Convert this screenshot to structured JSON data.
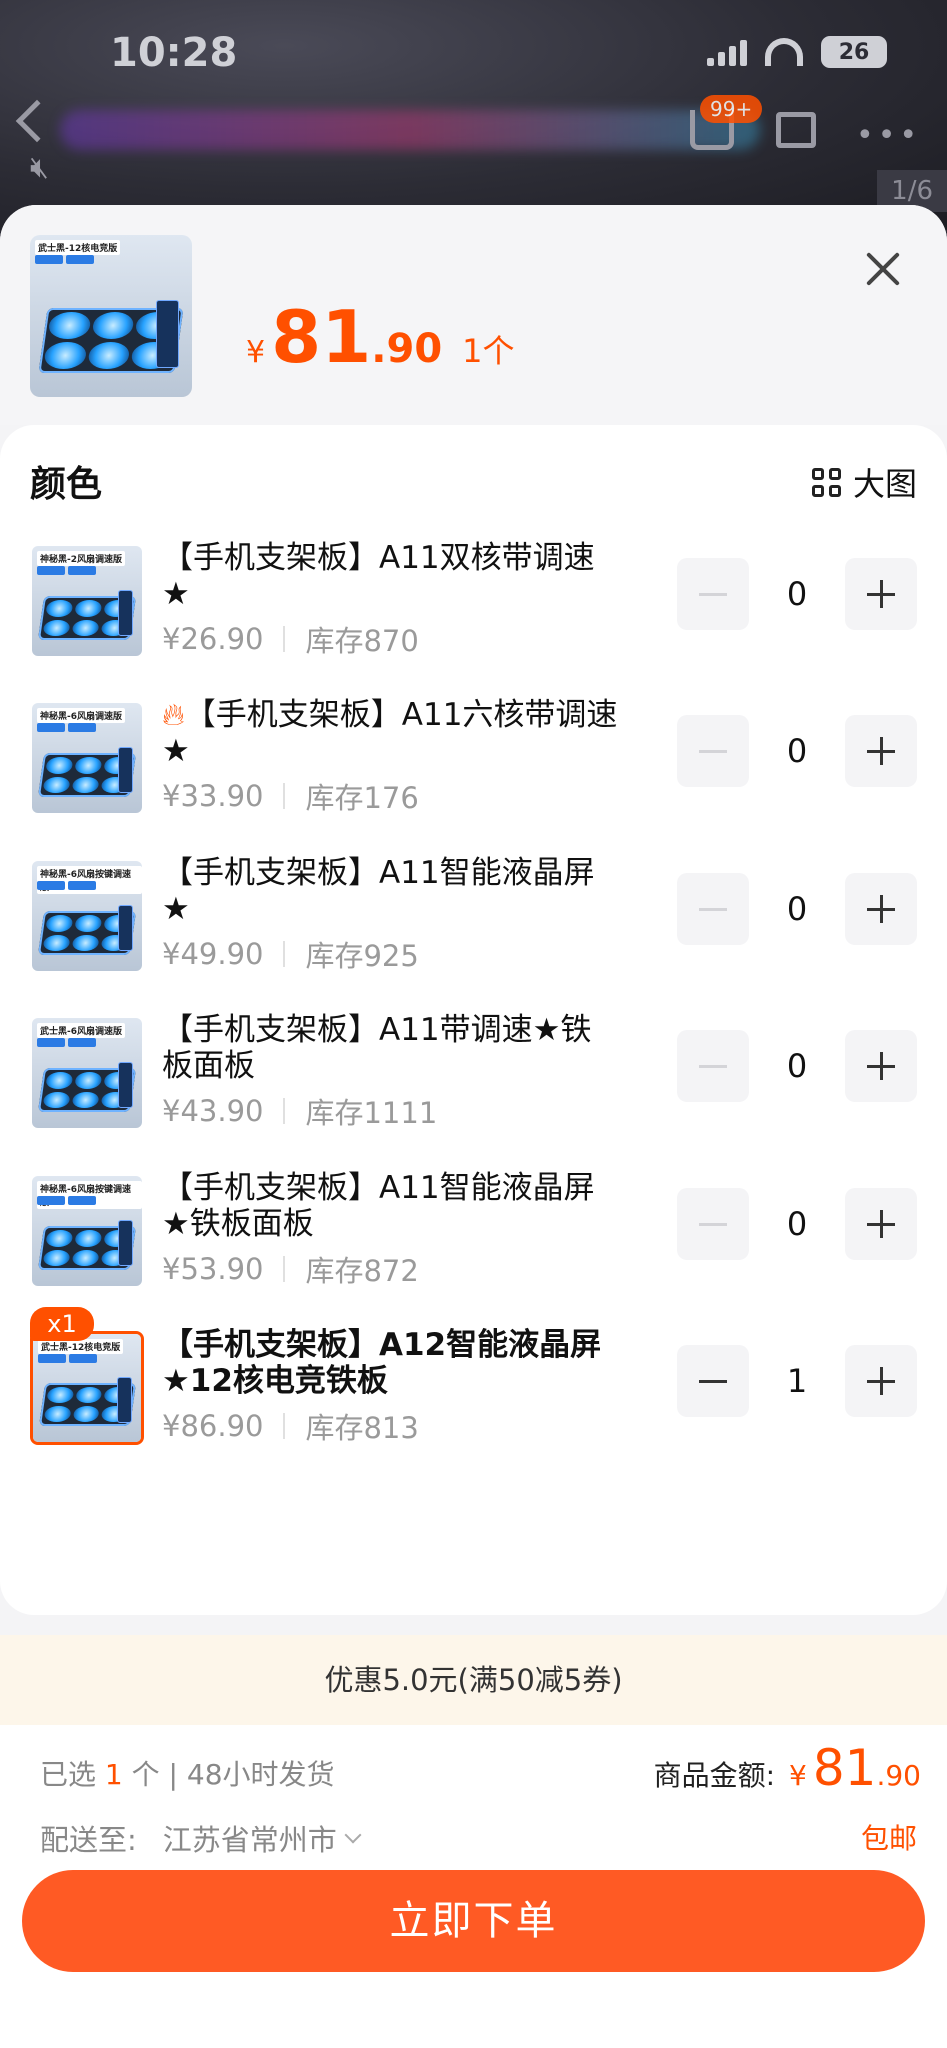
{
  "status_bar": {
    "time": "10:28",
    "battery": "26"
  },
  "top_nav": {
    "cart_badge": "99+",
    "pager": "1/6"
  },
  "sheet": {
    "price_currency": "¥",
    "price_int": "81",
    "price_dec": ".90",
    "quantity": "1个",
    "section_title": "颜色",
    "big_image_label": "大图",
    "head_thumb_label": "武士黑-12核电竞版"
  },
  "items": [
    {
      "name": "【手机支架板】A11双核带调速★",
      "price": "¥26.90",
      "stock": "库存870",
      "qty": "0",
      "thumb_label": "神秘黑-2风扇调速版",
      "selected": false,
      "hot": false
    },
    {
      "name": "【手机支架板】A11六核带调速★",
      "price": "¥33.90",
      "stock": "库存176",
      "qty": "0",
      "thumb_label": "神秘黑-6风扇调速版",
      "selected": false,
      "hot": true
    },
    {
      "name": "【手机支架板】A11智能液晶屏★",
      "price": "¥49.90",
      "stock": "库存925",
      "qty": "0",
      "thumb_label": "神秘黑-6风扇按键调速版",
      "selected": false,
      "hot": false
    },
    {
      "name": "【手机支架板】A11带调速★铁板面板",
      "price": "¥43.90",
      "stock": "库存1111",
      "qty": "0",
      "thumb_label": "武士黑-6风扇调速版",
      "selected": false,
      "hot": false
    },
    {
      "name": "【手机支架板】A11智能液晶屏★铁板面板",
      "price": "¥53.90",
      "stock": "库存872",
      "qty": "0",
      "thumb_label": "神秘黑-6风扇按键调速版",
      "selected": false,
      "hot": false
    },
    {
      "name": "【手机支架板】A12智能液晶屏★12核电竞铁板",
      "price": "¥86.90",
      "stock": "库存813",
      "qty": "1",
      "thumb_label": "武士黑-12核电竞版",
      "selected": true,
      "badge": "x1",
      "hot": false
    }
  ],
  "promo": {
    "text": "优惠5.0元(满50减5券)"
  },
  "footer": {
    "selected_prefix": "已选",
    "selected_count": "1",
    "selected_suffix": "个 | 48小时发货",
    "amount_label": "商品金额:",
    "amount_currency": "¥",
    "amount_int": "81",
    "amount_dec": ".90",
    "ship_label": "配送至:",
    "ship_city": "江苏省常州市",
    "free_shipping": "包邮",
    "buy_button": "立即下单"
  },
  "colors": {
    "accent": "#ff5000",
    "buy_button": "#ff5a24",
    "promo_bg": "#fdf6ea"
  }
}
